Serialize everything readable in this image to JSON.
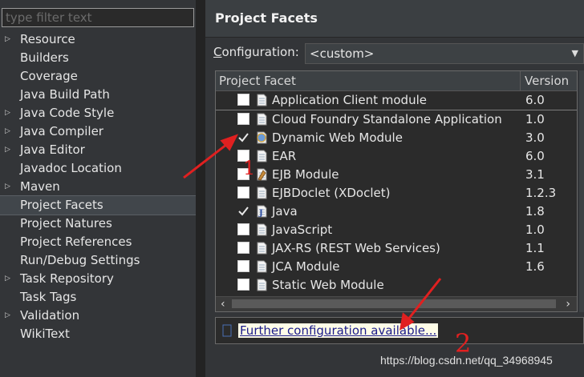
{
  "sidebar": {
    "filter_placeholder": "type filter text",
    "items": [
      {
        "label": "Resource",
        "expandable": true
      },
      {
        "label": "Builders",
        "expandable": false
      },
      {
        "label": "Coverage",
        "expandable": false
      },
      {
        "label": "Java Build Path",
        "expandable": false
      },
      {
        "label": "Java Code Style",
        "expandable": true
      },
      {
        "label": "Java Compiler",
        "expandable": true
      },
      {
        "label": "Java Editor",
        "expandable": true
      },
      {
        "label": "Javadoc Location",
        "expandable": false
      },
      {
        "label": "Maven",
        "expandable": true
      },
      {
        "label": "Project Facets",
        "expandable": false,
        "selected": true
      },
      {
        "label": "Project Natures",
        "expandable": false
      },
      {
        "label": "Project References",
        "expandable": false
      },
      {
        "label": "Run/Debug Settings",
        "expandable": false
      },
      {
        "label": "Task Repository",
        "expandable": true
      },
      {
        "label": "Task Tags",
        "expandable": false
      },
      {
        "label": "Validation",
        "expandable": true
      },
      {
        "label": "WikiText",
        "expandable": false
      }
    ]
  },
  "page": {
    "title": "Project Facets",
    "config_label_mnemonic": "C",
    "config_label_rest": "onfiguration:",
    "config_value": "<custom>"
  },
  "table": {
    "col_facet": "Project Facet",
    "col_version": "Version",
    "rows": [
      {
        "name": "Application Client module",
        "version": "6.0",
        "checked": false,
        "icon": "document-icon"
      },
      {
        "name": "Cloud Foundry Standalone Application",
        "version": "1.0",
        "checked": false,
        "icon": "document-icon"
      },
      {
        "name": "Dynamic Web Module",
        "version": "3.0",
        "checked": true,
        "icon": "web-module-icon"
      },
      {
        "name": "EAR",
        "version": "6.0",
        "checked": false,
        "icon": "document-icon"
      },
      {
        "name": "EJB Module",
        "version": "3.1",
        "checked": false,
        "icon": "ejb-icon"
      },
      {
        "name": "EJBDoclet (XDoclet)",
        "version": "1.2.3",
        "checked": false,
        "icon": "document-icon"
      },
      {
        "name": "Java",
        "version": "1.8",
        "checked": true,
        "icon": "java-icon"
      },
      {
        "name": "JavaScript",
        "version": "1.0",
        "checked": false,
        "icon": "document-icon"
      },
      {
        "name": "JAX-RS (REST Web Services)",
        "version": "1.1",
        "checked": false,
        "icon": "document-icon"
      },
      {
        "name": "JCA Module",
        "version": "1.6",
        "checked": false,
        "icon": "document-icon"
      },
      {
        "name": "Static Web Module",
        "version": "",
        "checked": false,
        "icon": "document-icon"
      }
    ]
  },
  "further": {
    "link_text": "Further configuration available..."
  },
  "annotations": {
    "label1": "1",
    "label2": "2",
    "color": "#e02020"
  },
  "watermark": "https://blog.csdn.net/qq_34968945"
}
